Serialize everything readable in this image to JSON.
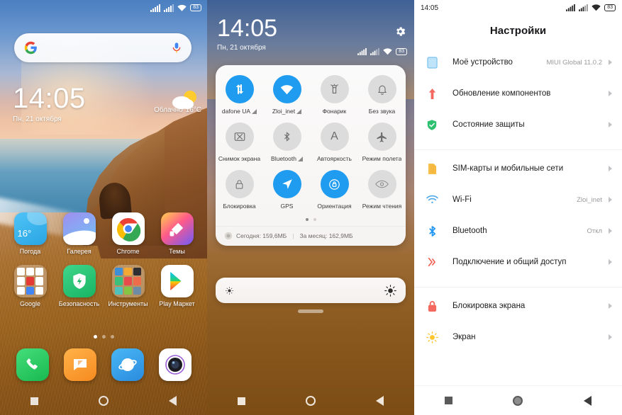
{
  "home": {
    "status_bar": {
      "signal1": "signal-bars-icon",
      "signal2": "signal-bars-icon",
      "wifi": "wifi-icon",
      "battery_text": "83"
    },
    "search_widget": {
      "logo": "google-g-icon",
      "mic": "microphone-icon",
      "placeholder": ""
    },
    "clock": {
      "time": "14:05",
      "date": "Пн, 21 октября"
    },
    "weather": {
      "condition": "Облачно",
      "temperature": "16°C",
      "icon": "partly-cloudy-icon"
    },
    "apps_row1": [
      {
        "label": "Погода",
        "icon": "weather-app-icon",
        "badge": "16°"
      },
      {
        "label": "Галерея",
        "icon": "gallery-app-icon"
      },
      {
        "label": "Chrome",
        "icon": "chrome-app-icon"
      },
      {
        "label": "Темы",
        "icon": "themes-app-icon"
      }
    ],
    "apps_row2": [
      {
        "label": "Google",
        "icon": "google-folder-icon"
      },
      {
        "label": "Безопасность",
        "icon": "security-app-icon"
      },
      {
        "label": "Инструменты",
        "icon": "tools-folder-icon"
      },
      {
        "label": "Play Маркет",
        "icon": "play-store-app-icon"
      }
    ],
    "page_dots": {
      "count": 3,
      "active": 0
    },
    "dock": [
      {
        "label": "Телефон",
        "icon": "phone-app-icon"
      },
      {
        "label": "Сообщения",
        "icon": "messages-app-icon"
      },
      {
        "label": "Браузер",
        "icon": "browser-app-icon"
      },
      {
        "label": "Камера",
        "icon": "camera-app-icon"
      }
    ],
    "nav": {
      "recents": "recents-square-icon",
      "home": "home-circle-icon",
      "back": "back-triangle-icon"
    }
  },
  "quick_settings": {
    "clock": {
      "time": "14:05",
      "date": "Пн, 21 октября"
    },
    "gear": "settings-gear-icon",
    "status_bar": {
      "signal1": "signal-bars-icon",
      "signal2": "signal-bars-icon",
      "wifi": "wifi-icon",
      "battery_text": "83"
    },
    "tiles_row1": [
      {
        "label": "dafone UA",
        "icon": "mobile-data-icon",
        "state": "on",
        "has_sim_badge": true
      },
      {
        "label": "Zloi_inet",
        "icon": "wifi-icon",
        "state": "on",
        "has_sim_badge": true
      },
      {
        "label": "Фонарик",
        "icon": "flashlight-icon",
        "state": "off",
        "has_sim_badge": false
      },
      {
        "label": "Без звука",
        "icon": "bell-mute-icon",
        "state": "off",
        "has_sim_badge": false
      }
    ],
    "tiles_row2": [
      {
        "label": "Снимок экрана",
        "icon": "screenshot-icon",
        "state": "off",
        "has_sim_badge": false
      },
      {
        "label": "Bluetooth",
        "icon": "bluetooth-icon",
        "state": "off",
        "has_sim_badge": true
      },
      {
        "label": "Автояркость",
        "icon": "auto-brightness-icon",
        "state": "off",
        "has_sim_badge": false
      },
      {
        "label": "Режим полета",
        "icon": "airplane-icon",
        "state": "off",
        "has_sim_badge": false
      }
    ],
    "tiles_row3": [
      {
        "label": "Блокировка",
        "icon": "lock-icon",
        "state": "off",
        "has_sim_badge": false
      },
      {
        "label": "GPS",
        "icon": "location-arrow-icon",
        "state": "on",
        "has_sim_badge": false
      },
      {
        "label": "Ориентация",
        "icon": "rotation-lock-icon",
        "state": "on",
        "has_sim_badge": false
      },
      {
        "label": "Режим чтения",
        "icon": "eye-reading-icon",
        "state": "off",
        "has_sim_badge": false
      }
    ],
    "page_dots": {
      "count": 2,
      "active": 0
    },
    "data_usage": {
      "icon": "data-usage-icon",
      "today": "Сегодня: 159,6МБ",
      "separator": "|",
      "month": "За месяц: 162,9МБ"
    },
    "brightness": {
      "low_icon": "brightness-low-icon",
      "high_icon": "brightness-high-icon",
      "value_percent": 0
    },
    "nav": {
      "recents": "recents-square-icon",
      "home": "home-circle-icon",
      "back": "back-triangle-icon"
    }
  },
  "settings": {
    "status_bar": {
      "time": "14:05",
      "signal1": "signal-bars-icon",
      "signal2": "signal-bars-icon",
      "wifi": "wifi-icon",
      "battery_text": "83"
    },
    "title": "Настройки",
    "groups": [
      {
        "items": [
          {
            "label": "Моё устройство",
            "value": "MIUI Global 11.0.2",
            "icon": "device-icon",
            "color": "#8ec9f0"
          },
          {
            "label": "Обновление компонентов",
            "value": "",
            "icon": "update-arrow-icon",
            "color": "#f4695f"
          },
          {
            "label": "Состояние защиты",
            "value": "",
            "icon": "shield-check-icon",
            "color": "#2dc06e"
          }
        ]
      },
      {
        "items": [
          {
            "label": "SIM-карты и мобильные сети",
            "value": "",
            "icon": "sim-card-icon",
            "color": "#f5b942"
          },
          {
            "label": "Wi-Fi",
            "value": "Zloi_inet",
            "icon": "wifi-icon",
            "color": "#4fa8e8"
          },
          {
            "label": "Bluetooth",
            "value": "Откл",
            "icon": "bluetooth-icon",
            "color": "#2196f3"
          },
          {
            "label": "Подключение и общий доступ",
            "value": "",
            "icon": "sharing-icon",
            "color": "#ef5b4c"
          }
        ]
      },
      {
        "items": [
          {
            "label": "Блокировка экрана",
            "value": "",
            "icon": "lock-red-icon",
            "color": "#f4695f"
          },
          {
            "label": "Экран",
            "value": "",
            "icon": "brightness-sun-icon",
            "color": "#ffc42e"
          }
        ]
      }
    ],
    "nav": {
      "recents": "recents-square-icon",
      "home": "home-circle-icon",
      "back": "back-triangle-icon"
    }
  }
}
